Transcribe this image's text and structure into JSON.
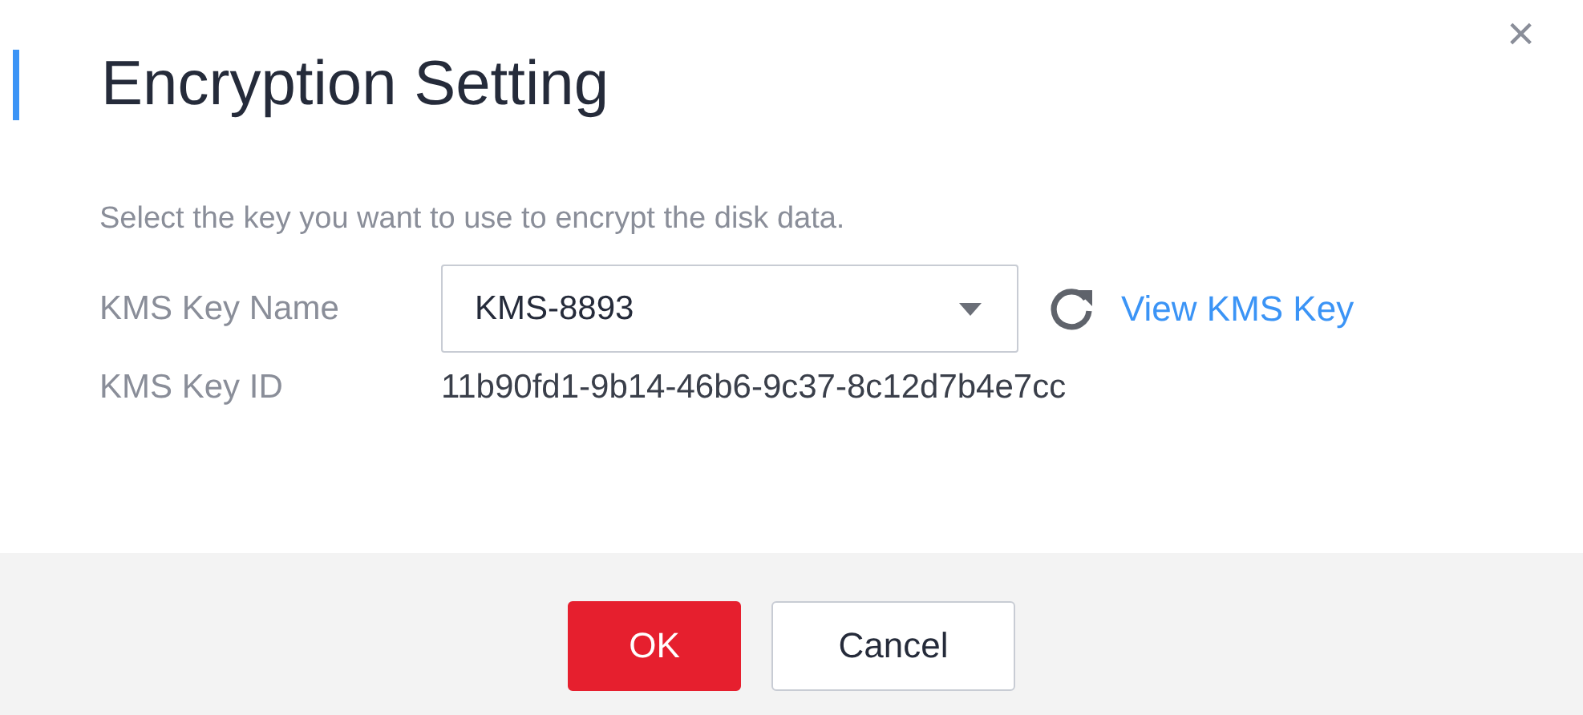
{
  "dialog": {
    "title": "Encryption Setting",
    "close": "×",
    "description": "Select the key you want to use to encrypt the disk data.",
    "fields": [
      {
        "kind": "select",
        "label": "KMS Key Name",
        "value": "KMS-8893",
        "link": "View KMS Key"
      },
      {
        "kind": "text",
        "label": "KMS Key ID",
        "value": "11b90fd1-9b14-46b6-9c37-8c12d7b4e7cc"
      }
    ],
    "buttons": [
      {
        "label": "OK",
        "kind": "primary"
      },
      {
        "label": "Cancel",
        "kind": "default"
      }
    ]
  }
}
